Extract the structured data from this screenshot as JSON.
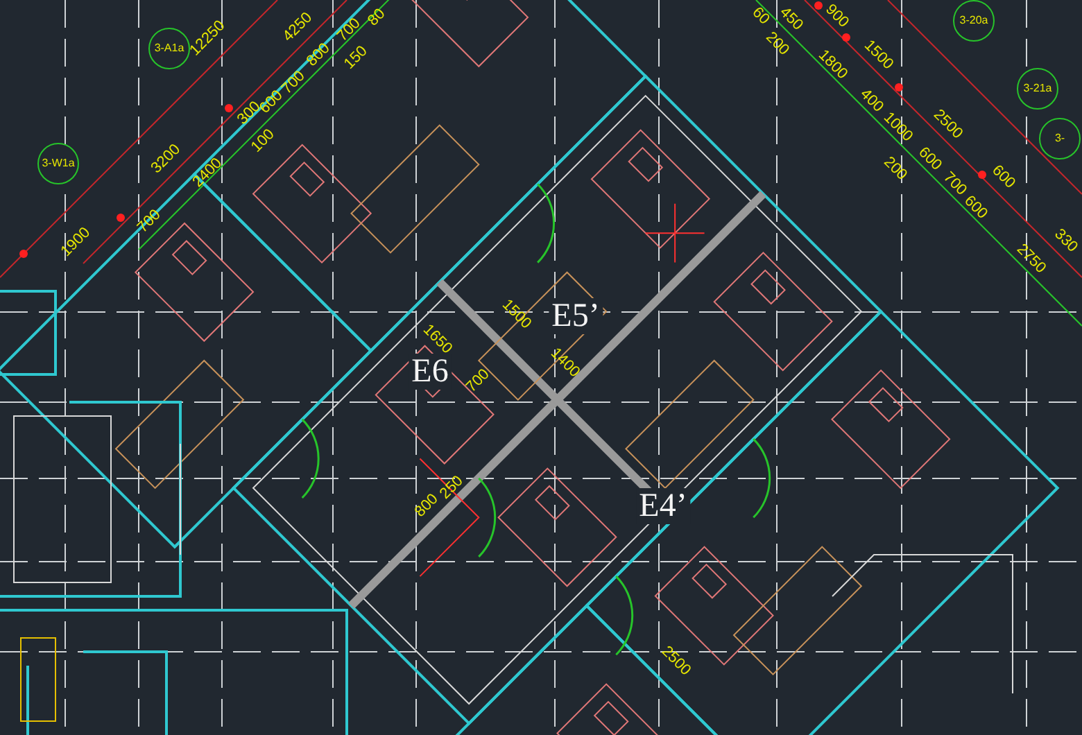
{
  "drawing": {
    "units": [
      {
        "label": "E6"
      },
      {
        "label": "E5’"
      },
      {
        "label": "E4’"
      }
    ],
    "axis_bubbles": [
      {
        "label": "3-A1a"
      },
      {
        "label": "3-W1a"
      },
      {
        "label": "3-20a"
      },
      {
        "label": "3-21a"
      },
      {
        "label": "3-"
      }
    ],
    "dimensions_ascending": [
      "12250",
      "4250",
      "3200",
      "2400",
      "1900",
      "700",
      "300",
      "600",
      "100",
      "700",
      "800",
      "700",
      "150",
      "80"
    ],
    "dimensions_descending": [
      "60",
      "450",
      "200",
      "900",
      "1800",
      "1500",
      "2500",
      "400",
      "1000",
      "200",
      "600",
      "700",
      "600",
      "600",
      "330",
      "2750"
    ],
    "plan_dimensions": [
      {
        "text": "1500",
        "kind": "descending"
      },
      {
        "text": "1650",
        "kind": "descending"
      },
      {
        "text": "700",
        "kind": "ascending"
      },
      {
        "text": "1400",
        "kind": "descending"
      },
      {
        "text": "800",
        "kind": "ascending"
      },
      {
        "text": "250",
        "kind": "ascending"
      },
      {
        "text": "2500",
        "kind": "descending"
      }
    ]
  }
}
